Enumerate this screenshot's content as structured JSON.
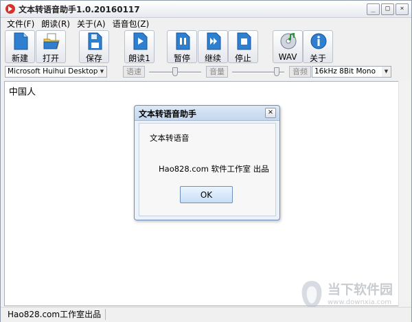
{
  "window": {
    "title": "文本转语音助手1.0.20160117",
    "controls": {
      "minimize": "_",
      "maximize": "□",
      "close": "×"
    }
  },
  "menu": [
    "文件(F)",
    "朗读(R)",
    "关于(A)",
    "语音包(Z)"
  ],
  "toolbar": {
    "new": "新建",
    "open": "打开",
    "save": "保存",
    "read": "朗读1",
    "pause": "暂停",
    "resume": "继续",
    "stop": "停止",
    "wav": "WAV",
    "about": "关于"
  },
  "options": {
    "voice": "Microsoft Huihui Desktop - Chinese",
    "rate_label": "语速",
    "volume_label": "音量",
    "freq_label": "音频",
    "freq_value": "16kHz  8Bit  Mono",
    "rate_level": 0.5,
    "volume_level": 0.9
  },
  "editor": {
    "text": "中国人"
  },
  "dialog": {
    "title": "文本转语音助手",
    "heading": "文本转语音",
    "message": "Hao828.com 软件工作室 出品",
    "ok": "OK",
    "close": "×"
  },
  "status": {
    "text": "Hao828.com工作室出品"
  },
  "watermark": {
    "line1": "当下软件园",
    "line2": "www.downxia.com"
  }
}
